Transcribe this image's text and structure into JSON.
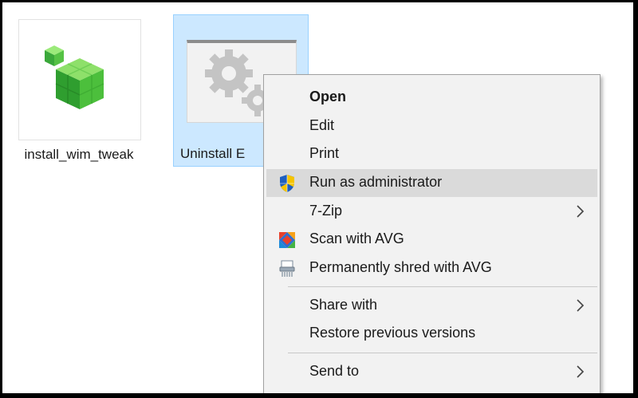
{
  "files": {
    "install": {
      "label": "install_wim_tweak"
    },
    "uninstall": {
      "label": "Uninstall E"
    }
  },
  "context_menu": {
    "items": [
      {
        "label": "Open",
        "bold": true
      },
      {
        "label": "Edit"
      },
      {
        "label": "Print"
      },
      {
        "label": "Run as administrator",
        "icon": "uac-shield-icon",
        "highlighted": true
      },
      {
        "label": "7-Zip",
        "submenu": true
      },
      {
        "label": "Scan with AVG",
        "icon": "avg-icon"
      },
      {
        "label": "Permanently shred with AVG",
        "icon": "avg-shredder-icon"
      },
      {
        "label": "Share with",
        "submenu": true
      },
      {
        "label": "Restore previous versions"
      },
      {
        "label": "Send to",
        "submenu": true
      }
    ]
  },
  "colors": {
    "selection_bg": "#cce8ff",
    "menu_bg": "#f2f2f2",
    "menu_highlight": "#dadada",
    "registry_icon_green": "#3db23d"
  }
}
